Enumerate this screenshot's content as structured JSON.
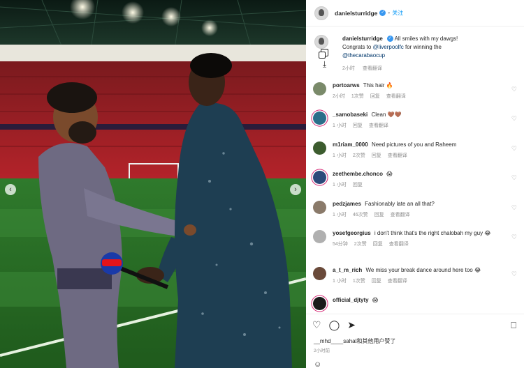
{
  "header": {
    "username": "danielsturridge",
    "follow_label": "关注",
    "dot": "•"
  },
  "caption": {
    "username": "danielsturridge",
    "text_1": "All smiles with my dawgs!",
    "text_2": "Congrats to",
    "mention_1": "@liverpoolfc",
    "text_3": "for winning the",
    "mention_2": "@thecarabaocup",
    "time": "2小时",
    "translate": "查看翻译"
  },
  "comments": [
    {
      "username": "portoarws",
      "text": "This hair 🔥",
      "time": "2小时",
      "likes": "1次赞",
      "reply": "回复",
      "translate": "查看翻译",
      "avatar_color": "#7a8a6a"
    },
    {
      "username": "_samobaseki",
      "text": "Clean 🤎🤎",
      "time": "1 小时",
      "likes": "",
      "reply": "回复",
      "translate": "查看翻译",
      "avatar_color": "#2b6e8a"
    },
    {
      "username": "m1riam_0000",
      "text": "Need pictures of you and Raheem",
      "time": "1 小时",
      "likes": "2次赞",
      "reply": "回复",
      "translate": "查看翻译",
      "avatar_color": "#3c5c2e"
    },
    {
      "username": "zeethembe.chonco",
      "text": "😱",
      "time": "1 小时",
      "likes": "",
      "reply": "回复",
      "translate": "",
      "avatar_color": "#2c4a7a"
    },
    {
      "username": "pedzjames",
      "text": "Fashionably late an all that?",
      "time": "1 小时",
      "likes": "46次赞",
      "reply": "回复",
      "translate": "查看翻译",
      "avatar_color": "#8a7a6a"
    },
    {
      "username": "yosefgeorgius",
      "text": "i don't think that's the right chalobah my guy 😂",
      "time": "54分钟",
      "likes": "2次赞",
      "reply": "回复",
      "translate": "查看翻译",
      "avatar_color": "#b0b0b0"
    },
    {
      "username": "a_t_m_rich",
      "text": "We miss your break dance around here too 😂",
      "time": "1 小时",
      "likes": "1次赞",
      "reply": "回复",
      "translate": "查看翻译",
      "avatar_color": "#6a4a3a"
    },
    {
      "username": "official_djtyty",
      "text": "😱",
      "time": "",
      "likes": "",
      "reply": "",
      "translate": "",
      "avatar_color": "#1a1a1a"
    }
  ],
  "actions": {
    "like_icon": "heart-icon",
    "comment_icon": "comment-icon",
    "share_icon": "share-icon",
    "save_icon": "bookmark-icon",
    "likes_text": "__mhd____sahal和其他用户赞了",
    "post_time": "2小时前"
  },
  "icons": {
    "heart": "♡",
    "arrow_left": "‹",
    "arrow_right": "›",
    "download": "⤓"
  },
  "colors": {
    "link": "#00376b",
    "follow": "#0095f6",
    "meta": "#8e8e8e",
    "story_ring": "#d62976"
  }
}
